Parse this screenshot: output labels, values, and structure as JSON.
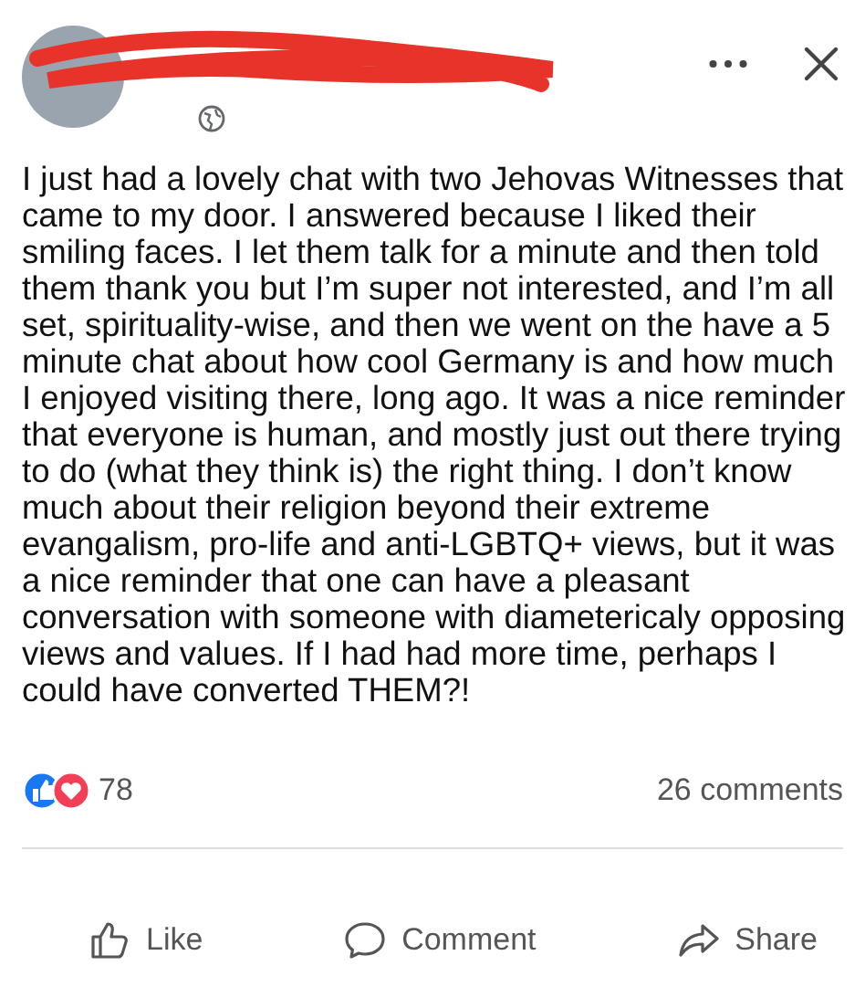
{
  "post": {
    "text": "I just had a lovely chat with two Jehovas Witnesses that came to my door. I answered because I liked their smiling faces. I let them talk for a minute and then told them thank you but I’m super not interested, and I’m all set, spirituality-wise, and then we went on the have a 5 minute chat about how cool Germany is and how much I enjoyed visiting there, long ago. It was a nice reminder that everyone is human, and mostly just out there trying to do (what they think is) the right thing. I don’t know much about their religion beyond their extreme evangalism, pro-life and anti-LGBTQ+ views, but it was a nice reminder that one can have a pleasant conversation with someone with diametericaly opposing views and values. If I had had more time, perhaps I could have converted THEM?!"
  },
  "reactions": {
    "count": "78"
  },
  "comments": "26 comments",
  "actions": [
    {
      "kind": "like",
      "label": "Like"
    },
    {
      "kind": "comment",
      "label": "Comment"
    },
    {
      "kind": "share",
      "label": "Share"
    }
  ]
}
